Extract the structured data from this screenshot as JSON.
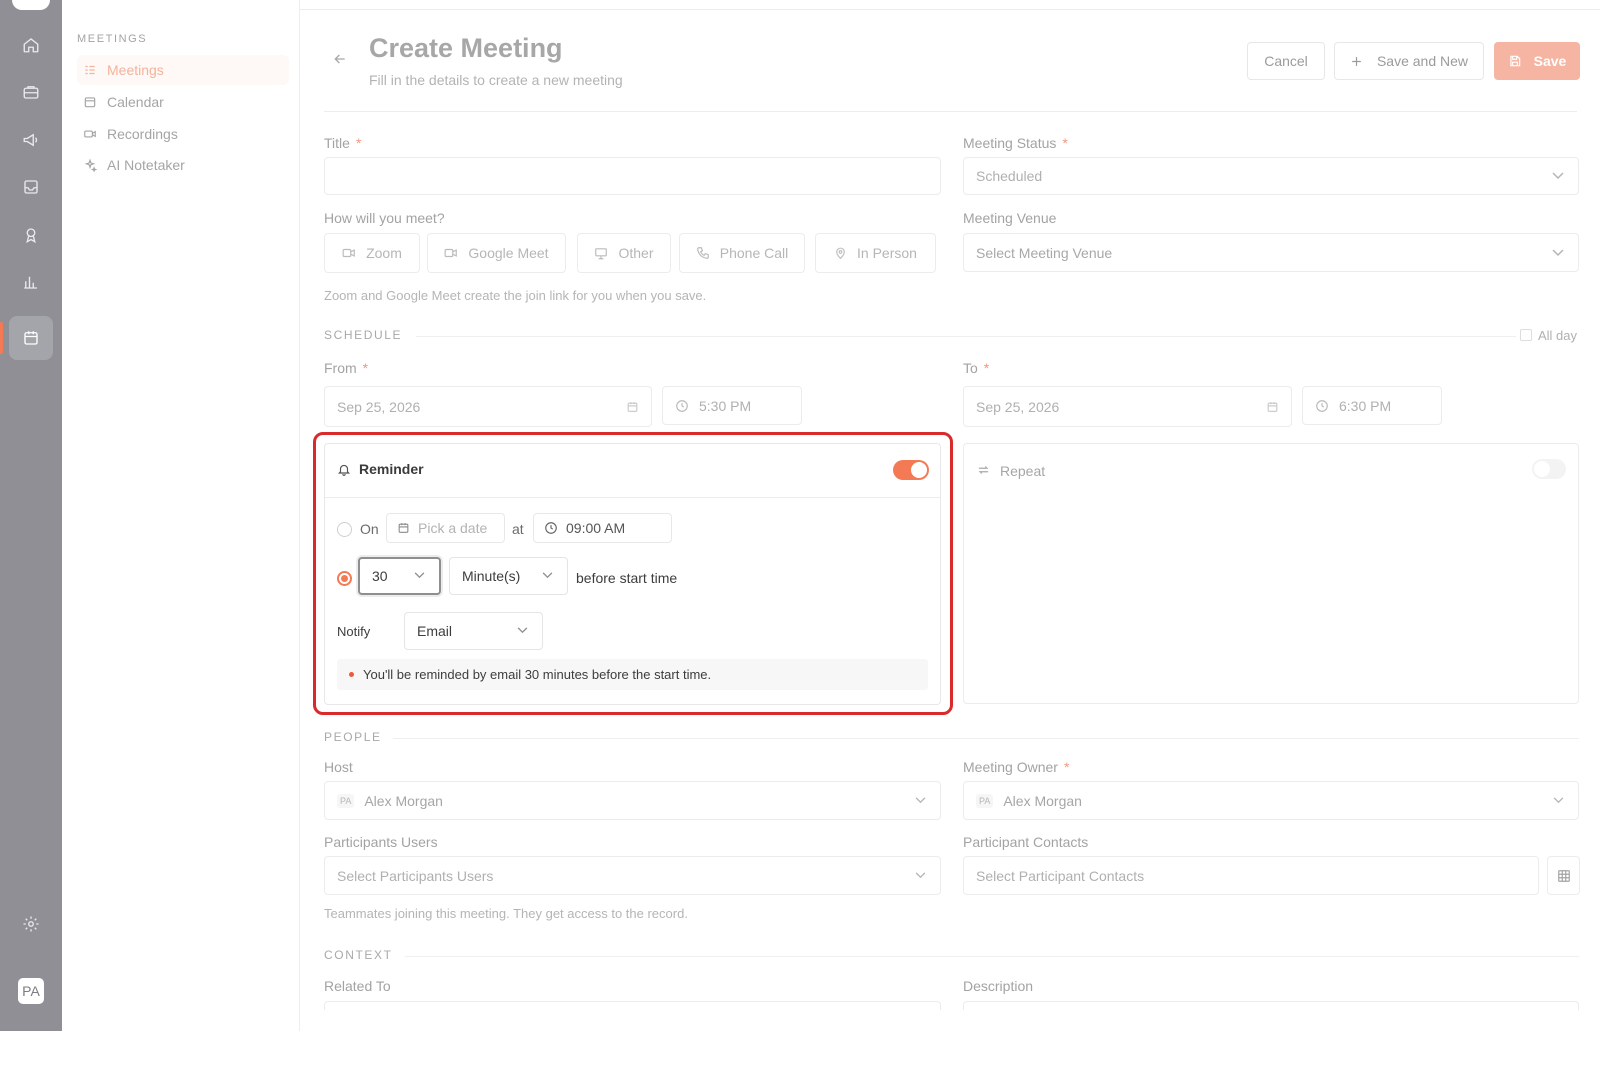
{
  "app": {
    "rail": {
      "icons": [
        "home-icon",
        "briefcase-icon",
        "megaphone-icon",
        "inbox-icon",
        "award-icon",
        "bar-chart-icon",
        "calendar-icon",
        "settings-icon"
      ],
      "avatar": "PA"
    },
    "sidebar": {
      "heading": "MEETINGS",
      "items": [
        {
          "label": "Meetings",
          "icon": "list-icon",
          "active": true
        },
        {
          "label": "Calendar",
          "icon": "calendar-icon",
          "active": false
        },
        {
          "label": "Recordings",
          "icon": "video-icon",
          "active": false
        },
        {
          "label": "AI Notetaker",
          "icon": "sparkles-icon",
          "active": false
        }
      ]
    }
  },
  "header": {
    "title": "Create Meeting",
    "subtitle": "Fill in the details to create a new meeting",
    "cancel": "Cancel",
    "save_and_new": "Save and New",
    "save": "Save"
  },
  "form": {
    "title_label": "Title",
    "title_value": "",
    "status_label": "Meeting Status",
    "status_value": "Scheduled",
    "how_label": "How will you meet?",
    "meet_options": [
      "Zoom",
      "Google Meet",
      "Other",
      "Phone Call",
      "In Person"
    ],
    "venue_label": "Meeting Venue",
    "venue_placeholder": "Select Meeting Venue",
    "meet_helper": "Zoom and Google Meet create the join link for you when you save.",
    "schedule_section": "SCHEDULE",
    "all_day": "All day",
    "from_label": "From",
    "from_date": "Sep 25, 2026",
    "from_time": "5:30 PM",
    "to_label": "To",
    "to_date": "Sep 25, 2026",
    "to_time": "6:30 PM",
    "reminder": {
      "title": "Reminder",
      "enabled": true,
      "on_label": "On",
      "pick_date": "Pick a date",
      "at": "at",
      "time": "09:00 AM",
      "amount": "30",
      "unit": "Minute(s)",
      "before": "before start time",
      "notify_label": "Notify",
      "notify_value": "Email",
      "summary": "You'll be reminded by email 30 minutes before the start time."
    },
    "repeat": {
      "title": "Repeat",
      "enabled": false
    },
    "people_section": "PEOPLE",
    "host_label": "Host",
    "host_initials": "PA",
    "host_value": "Alex Morgan",
    "owner_label": "Meeting Owner",
    "owner_initials": "PA",
    "owner_value": "Alex Morgan",
    "participants_users_label": "Participants Users",
    "participants_users_placeholder": "Select Participants Users",
    "participant_contacts_label": "Participant Contacts",
    "participant_contacts_placeholder": "Select Participant Contacts",
    "participants_helper": "Teammates joining this meeting. They get access to the record.",
    "context_section": "CONTEXT",
    "related_label": "Related To",
    "description_label": "Description"
  },
  "colors": {
    "accent": "#f47a56",
    "highlight": "#d92b2b",
    "rail": "#8f8f95"
  }
}
